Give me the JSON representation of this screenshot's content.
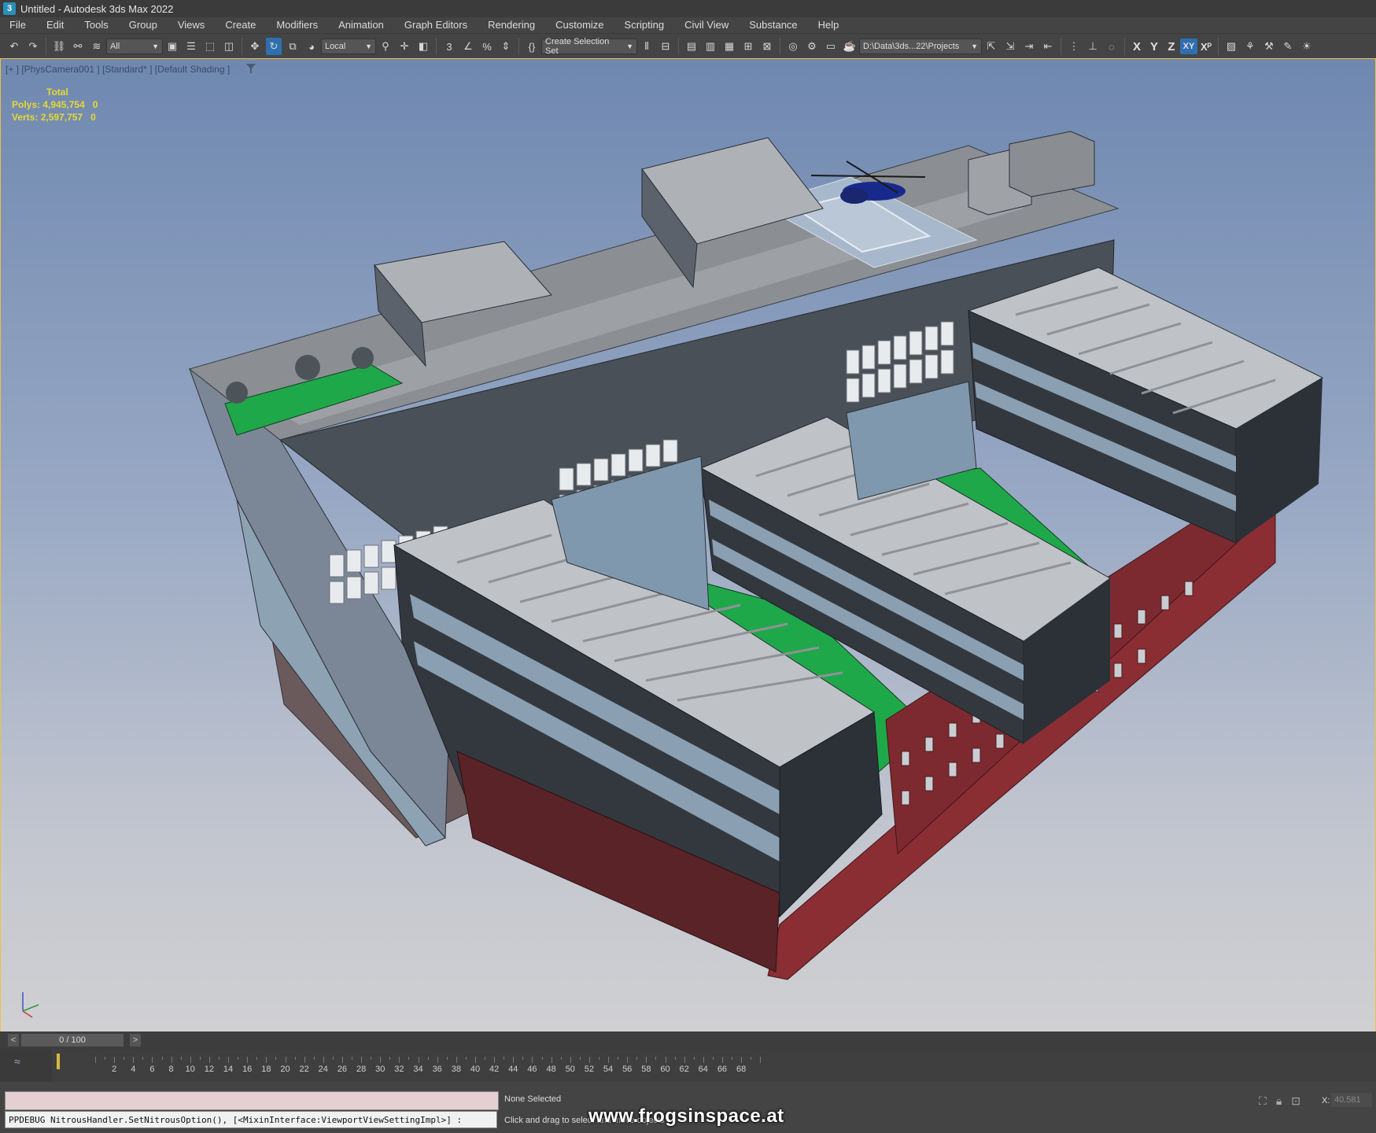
{
  "window": {
    "title": "Untitled - Autodesk 3ds Max 2022",
    "app_icon": "3"
  },
  "menu": [
    "File",
    "Edit",
    "Tools",
    "Group",
    "Views",
    "Create",
    "Modifiers",
    "Animation",
    "Graph Editors",
    "Rendering",
    "Customize",
    "Scripting",
    "Civil View",
    "Substance",
    "Help"
  ],
  "toolbar": {
    "selection_filter": "All",
    "reference_coord": "Local",
    "selection_set": "Create Selection Set",
    "project_path": "D:\\Data\\3ds...22\\Projects",
    "axis_x": "X",
    "axis_y": "Y",
    "axis_z": "Z",
    "axis_xy": "XY",
    "axis_xy_lock": "Xᴾ"
  },
  "viewport": {
    "label": "[+ ] [PhysCamera001 ] [Standard* ] [Default Shading ]",
    "stats": {
      "header": "Total",
      "polys_label": "Polys:",
      "polys_value": "4,945,754",
      "polys_sel": "0",
      "verts_label": "Verts:",
      "verts_value": "2,597,757",
      "verts_sel": "0"
    }
  },
  "timeline": {
    "frame_display": "0 / 100",
    "prev": "<",
    "next": ">",
    "ticks": [
      "2",
      "4",
      "6",
      "8",
      "10",
      "12",
      "14",
      "16",
      "18",
      "20",
      "22",
      "24",
      "26",
      "28",
      "30",
      "32",
      "34",
      "36",
      "38",
      "40",
      "42",
      "44",
      "46",
      "48",
      "50",
      "52",
      "54",
      "56",
      "58",
      "60",
      "62",
      "64",
      "66",
      "68"
    ]
  },
  "status": {
    "maxscript_output": "PPDEBUG NitrousHandler.SetNitrousOption(), [<MixinInterface:ViewportViewSettingImpl>] :",
    "selection": "None Selected",
    "prompt": "Click and drag to select and move objects",
    "watermark": "www.frogsinspace.at",
    "coord_x_label": "X:",
    "coord_x_value": "40.581"
  },
  "colors": {
    "accent": "#2f6fb0",
    "viewport_border": "#f0c040",
    "stats_text": "#e8d830",
    "roof_green": "#1fa84a",
    "brick": "#8a2e34"
  }
}
